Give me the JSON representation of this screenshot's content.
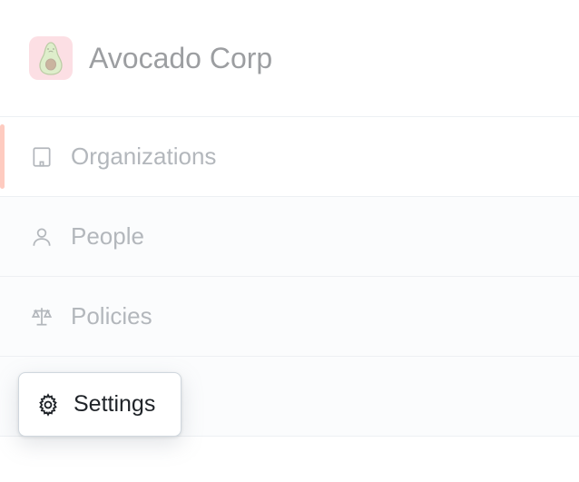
{
  "header": {
    "org_name": "Avocado Corp"
  },
  "nav": {
    "items": [
      {
        "label": "Organizations"
      },
      {
        "label": "People"
      },
      {
        "label": "Policies"
      },
      {
        "label": "Settings"
      }
    ]
  },
  "popout": {
    "label": "Settings"
  }
}
